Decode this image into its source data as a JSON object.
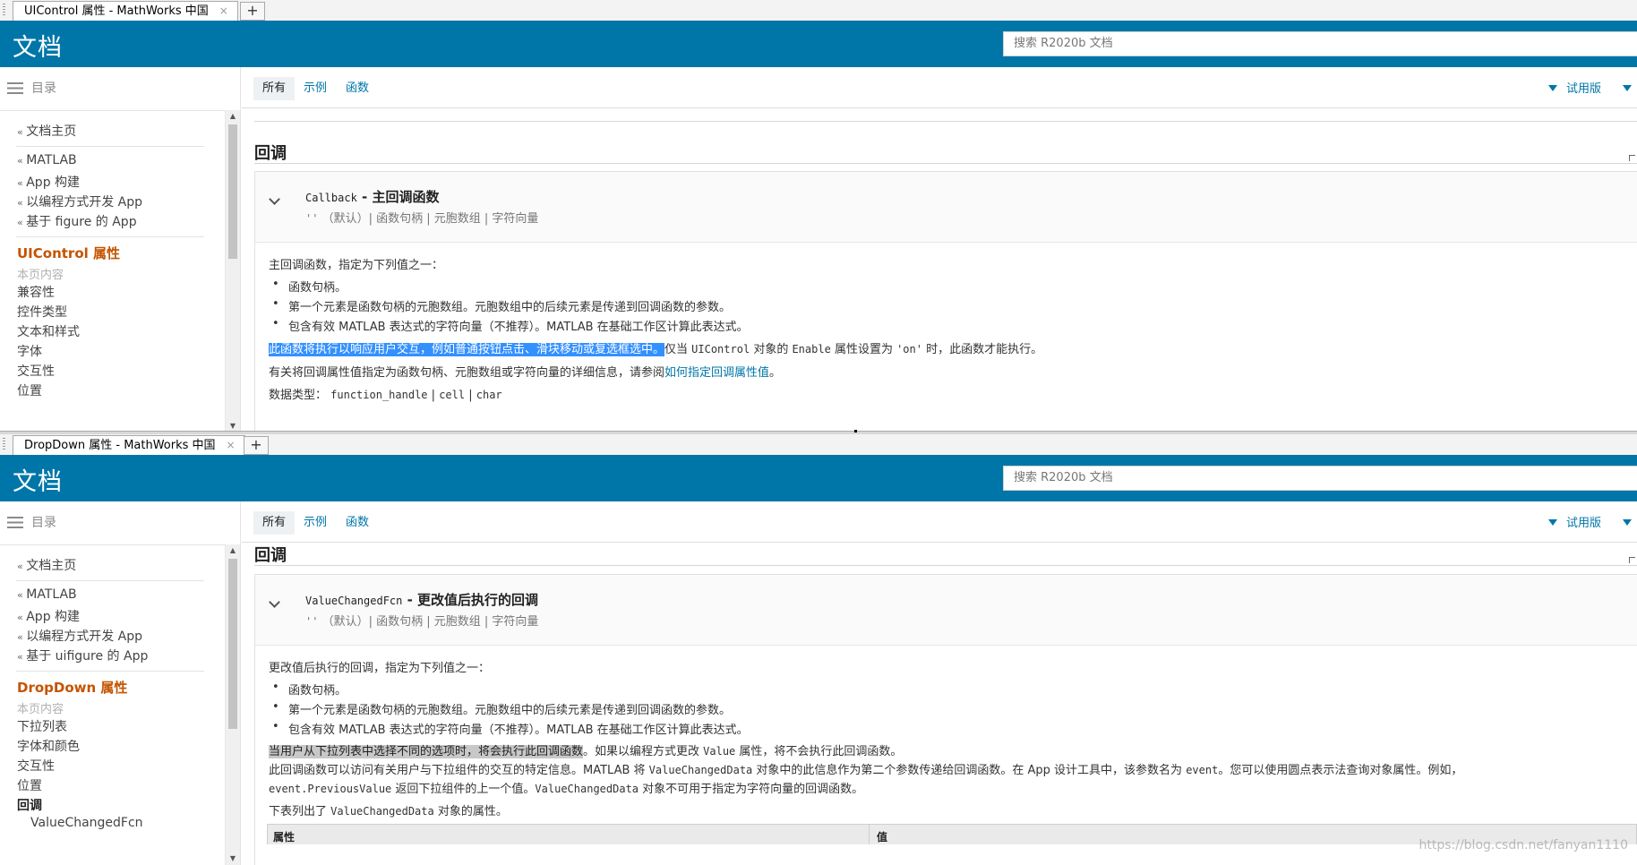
{
  "colors": {
    "banner": "#0076a8",
    "active_toc": "#c45400",
    "link": "#0076a8",
    "highlight_blue": "#3390ff",
    "highlight_gray": "#c8c8c8"
  },
  "common": {
    "brand": "文档",
    "search_placeholder": "搜索 R2020b 文档",
    "toc_label": "目录",
    "filter_tabs": [
      "所有",
      "示例",
      "函数"
    ],
    "trial_label": "试用版",
    "new_tab_label": "+",
    "close_label": "×",
    "section_title": "回调",
    "data_type_label": "数据类型：",
    "types_prefix": "''",
    "types_rest": "（默认）| 函数句柄 | 元胞数组 | 字符向量",
    "bullets": [
      "函数句柄。",
      "第一个元素是函数句柄的元胞数组。元胞数组中的后续元素是传递到回调函数的参数。",
      "包含有效 MATLAB 表达式的字符向量（不推荐）。MATLAB 在基础工作区计算此表达式。"
    ]
  },
  "paneA": {
    "tab_title": "UIControl 属性 - MathWorks 中国",
    "toc": {
      "home": "文档主页",
      "back_links": [
        "MATLAB",
        "App 构建",
        "以编程方式开发 App",
        "基于 figure 的 App"
      ],
      "current": "UIControl 属性",
      "on_this_page": "本页内容",
      "sections": [
        "兼容性",
        "控件类型",
        "文本和样式",
        "字体",
        "交互性",
        "位置"
      ]
    },
    "prop": {
      "code_name": "Callback",
      "sep": " - ",
      "desc": "主回调函数",
      "intro": "主回调函数，指定为下列值之一：",
      "highlighted": "此函数将执行以响应用户交互，例如普通按钮点击、滑块移动或复选框选中。",
      "after_hl_1": "仅当 ",
      "after_code_1": "UIControl",
      "after_hl_2": " 对象的 ",
      "after_code_2": "Enable",
      "after_hl_3": " 属性设置为 ",
      "after_code_3": "'on'",
      "after_hl_4": " 时，此函数才能执行。",
      "info_pre": "有关将回调属性值指定为函数句柄、元胞数组或字符向量的详细信息，请参阅",
      "info_link": "如何指定回调属性值",
      "info_post": "。",
      "data_types": [
        "function_handle",
        "cell",
        "char"
      ]
    }
  },
  "paneB": {
    "tab_title": "DropDown 属性 - MathWorks 中国",
    "toc": {
      "home": "文档主页",
      "back_links": [
        "MATLAB",
        "App 构建",
        "以编程方式开发 App",
        "基于 uifigure 的 App"
      ],
      "current": "DropDown 属性",
      "on_this_page": "本页内容",
      "sections": [
        "下拉列表",
        "字体和颜色",
        "交互性",
        "位置",
        "回调"
      ],
      "sub": "ValueChangedFcn"
    },
    "prop": {
      "code_name": "ValueChangedFcn",
      "sep": " - ",
      "desc": "更改值后执行的回调",
      "intro": "更改值后执行的回调，指定为下列值之一：",
      "highlighted": "当用户从下拉列表中选择不同的选项时，将会执行此回调函数",
      "after_hl_1": "。如果以编程方式更改 ",
      "after_code_1": "Value",
      "after_hl_2": " 属性，将不会执行此回调函数。",
      "para1_a": "此回调函数可以访问有关用户与下拉组件的交互的特定信息。MATLAB 将 ",
      "para1_code1": "ValueChangedData",
      "para1_b": " 对象中的此信息作为第二个参数传递给回调函数。在 App 设计工具中，该参数名为 ",
      "para1_code2": "event",
      "para1_c": "。您可以使用圆点表示法查询对象属性。例如，",
      "para1_code3": "event.PreviousValue",
      "para1_d": " 返回下拉组件的上一个值。",
      "para1_code4": "ValueChangedData",
      "para1_e": " 对象不可用于指定为字符向量的回调函数。",
      "para2_a": "下表列出了 ",
      "para2_code": "ValueChangedData",
      "para2_b": " 对象的属性。",
      "table_headers": [
        "属性",
        "值"
      ]
    }
  },
  "watermark": "https://blog.csdn.net/fanyan1110"
}
